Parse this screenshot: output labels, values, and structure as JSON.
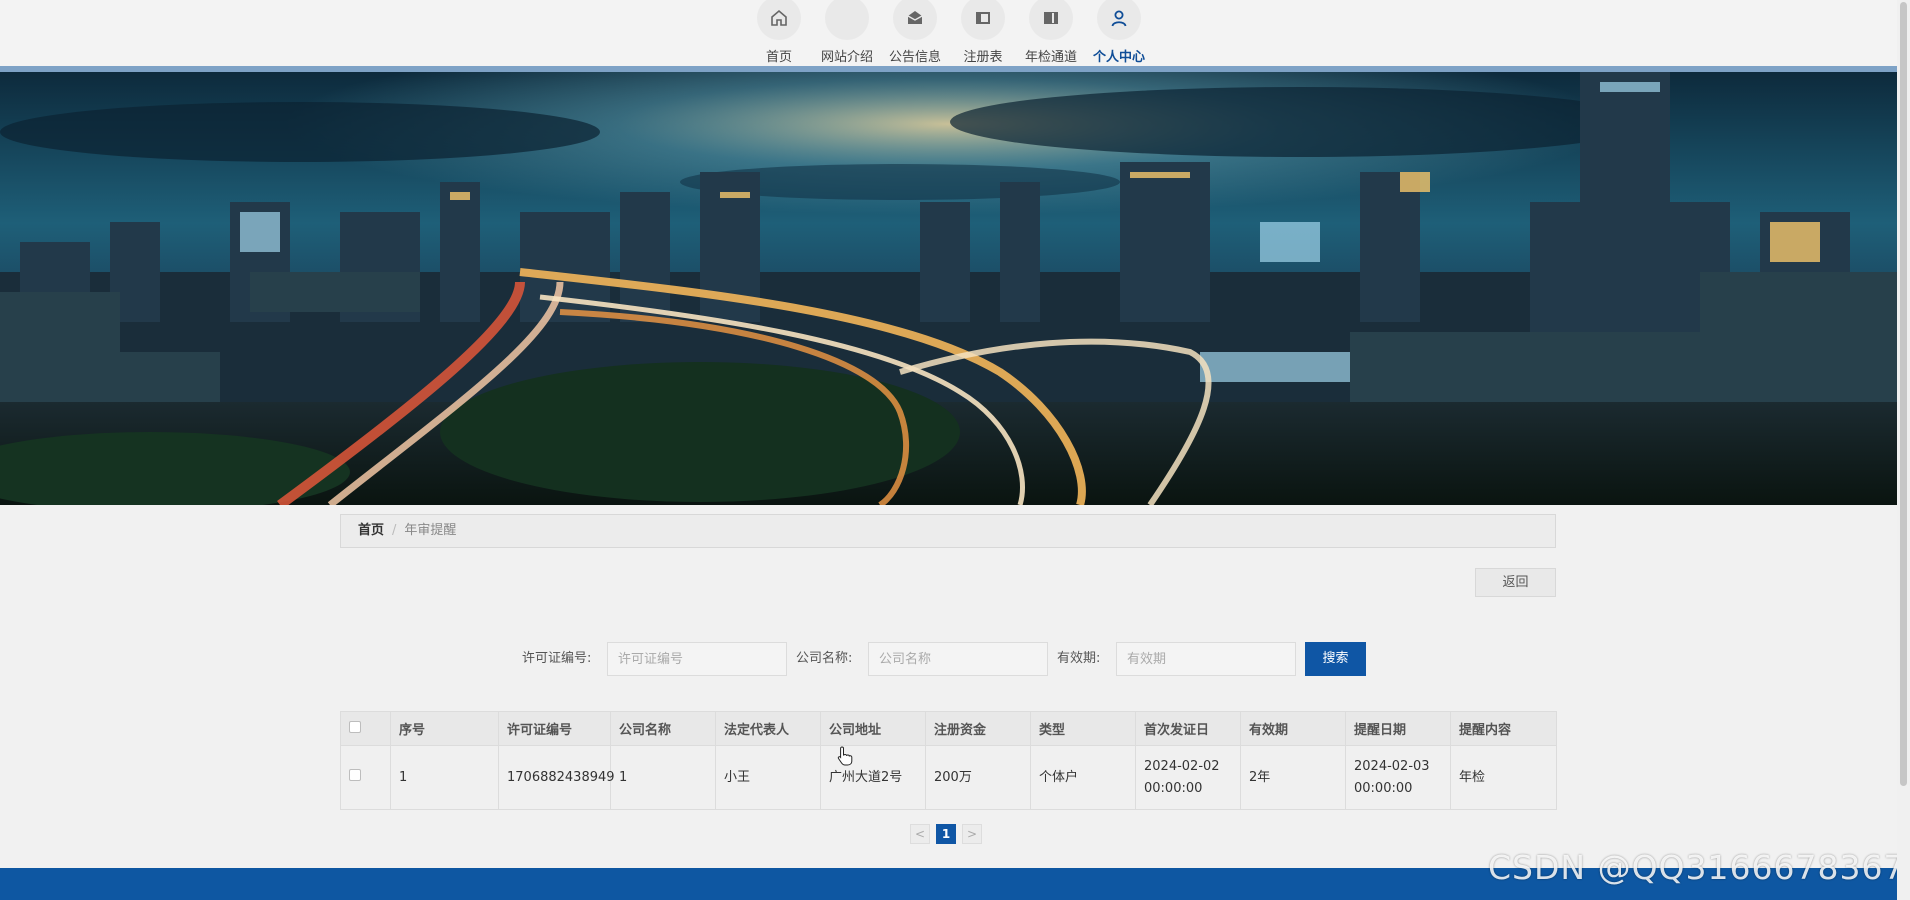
{
  "nav": {
    "items": [
      {
        "label": "首页",
        "icon": "home-icon"
      },
      {
        "label": "网站介绍",
        "icon": ""
      },
      {
        "label": "公告信息",
        "icon": "envelope-icon"
      },
      {
        "label": "注册表",
        "icon": "panel-icon"
      },
      {
        "label": "年检通道",
        "icon": "book-icon"
      },
      {
        "label": "个人中心",
        "icon": "user-icon",
        "active": true
      }
    ]
  },
  "breadcrumb": {
    "home": "首页",
    "separator": "/",
    "current": "年审提醒"
  },
  "back_label": "返回",
  "search": {
    "license_label": "许可证编号:",
    "license_placeholder": "许可证编号",
    "company_label": "公司名称:",
    "company_placeholder": "公司名称",
    "validity_label": "有效期:",
    "validity_placeholder": "有效期",
    "button": "搜索"
  },
  "table": {
    "headers": [
      "序号",
      "许可证编号",
      "公司名称",
      "法定代表人",
      "公司地址",
      "注册资金",
      "类型",
      "首次发证日",
      "有效期",
      "提醒日期",
      "提醒内容"
    ],
    "rows": [
      [
        "1",
        "1706882438949",
        "1",
        "小王",
        "广州大道2号",
        "200万",
        "个体户",
        "2024-02-02 00:00:00",
        "2年",
        "2024-02-03 00:00:00",
        "年检"
      ]
    ]
  },
  "pagination": {
    "prev": "<",
    "current": "1",
    "next": ">"
  },
  "watermark": "CSDN @QQ3166678367",
  "colors": {
    "accent": "#0f56a5",
    "footer": "#0e57a2",
    "active_nav": "#0f4d97"
  }
}
